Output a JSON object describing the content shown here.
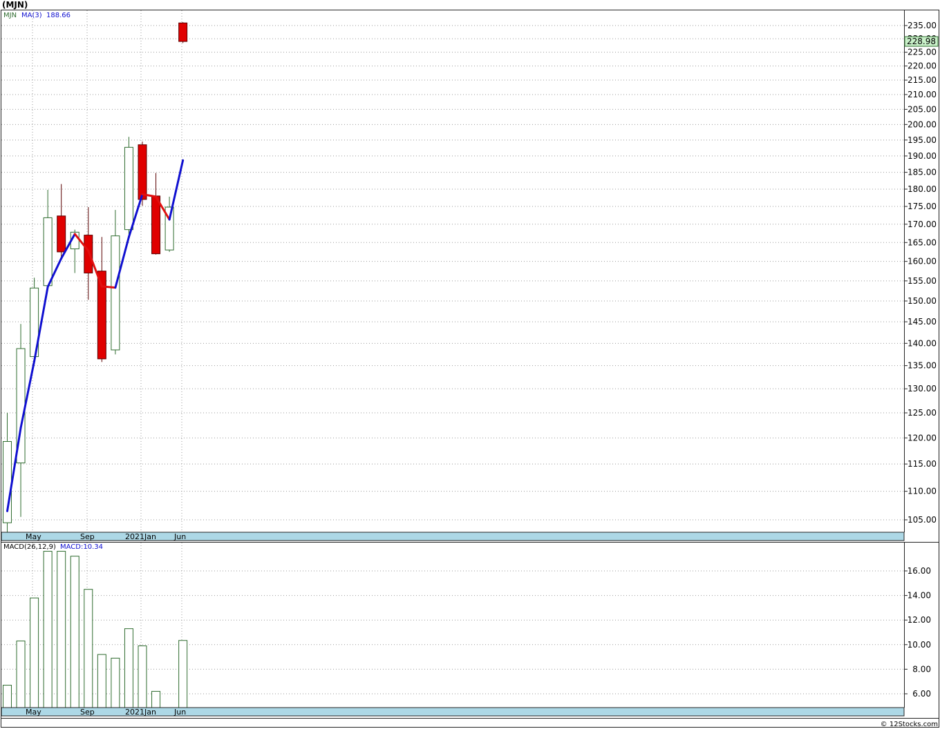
{
  "header": {
    "ticker_title": "(MJN)"
  },
  "price_panel": {
    "legend_symbol": "MJN",
    "legend_ma": "MA(3)",
    "legend_ma_value": "188.66",
    "current_price_label": "228.98"
  },
  "macd_panel": {
    "legend_params": "MACD(26,12,9)",
    "legend_value": "MACD:10.34"
  },
  "footer": {
    "watermark": "© 12Stocks.com"
  },
  "colors": {
    "up_candle_border": "#2e6b2e",
    "down_candle_fill": "#e00000",
    "ma_up": "#1010d0",
    "ma_down": "#e01010",
    "axis_band": "#add8e6",
    "price_label_bg": "#c8f0c8",
    "macd_bar": "#2e6b2e"
  },
  "chart_data": [
    {
      "type": "candlestick",
      "title": "(MJN)",
      "x_ticks": [
        "May",
        "Sep",
        "2021",
        "Jan",
        "Jun"
      ],
      "y_ticks": [
        "105.00",
        "110.00",
        "115.00",
        "120.00",
        "125.00",
        "130.00",
        "135.00",
        "140.00",
        "145.00",
        "150.00",
        "155.00",
        "160.00",
        "165.00",
        "170.00",
        "175.00",
        "180.00",
        "185.00",
        "190.00",
        "195.00",
        "200.00",
        "205.00",
        "210.00",
        "215.00",
        "220.00",
        "225.00",
        "230.00",
        "235.00"
      ],
      "ylim": [
        101.5,
        239
      ],
      "scale": "log",
      "grid": true,
      "candles": [
        {
          "open": 104.5,
          "high": 125.0,
          "low": 102.5,
          "close": 119.3
        },
        {
          "open": 115.2,
          "high": 144.5,
          "low": 105.5,
          "close": 138.8
        },
        {
          "open": 137.0,
          "high": 155.8,
          "low": 136.0,
          "close": 153.2
        },
        {
          "open": 153.8,
          "high": 179.8,
          "low": 153.0,
          "close": 171.8
        },
        {
          "open": 172.3,
          "high": 181.5,
          "low": 160.5,
          "close": 162.5
        },
        {
          "open": 163.3,
          "high": 168.5,
          "low": 157.0,
          "close": 167.8
        },
        {
          "open": 167.0,
          "high": 174.8,
          "low": 150.3,
          "close": 157.0
        },
        {
          "open": 157.5,
          "high": 166.5,
          "low": 135.8,
          "close": 136.5
        },
        {
          "open": 138.5,
          "high": 174.0,
          "low": 137.5,
          "close": 166.8
        },
        {
          "open": 168.5,
          "high": 196.0,
          "low": 167.0,
          "close": 192.7
        },
        {
          "open": 193.5,
          "high": 194.5,
          "low": 175.2,
          "close": 177.0
        },
        {
          "open": 178.0,
          "high": 184.8,
          "low": 161.8,
          "close": 162.0
        },
        {
          "open": 163.0,
          "high": 177.8,
          "low": 162.5,
          "close": 174.8
        },
        {
          "open": 236.0,
          "high": 236.3,
          "low": 228.4,
          "close": 228.98
        }
      ],
      "ma3": [
        106.5,
        122.0,
        136.0,
        153.5,
        160.8,
        167.3,
        162.8,
        153.6,
        153.3,
        166.5,
        178.5,
        177.8,
        171.3,
        188.66
      ]
    },
    {
      "type": "bar",
      "title": "MACD(26,12,9)",
      "x_ticks": [
        "May",
        "Sep",
        "2021",
        "Jan",
        "Jun"
      ],
      "y_ticks": [
        "6.00",
        "8.00",
        "10.00",
        "12.00",
        "14.00",
        "16.00"
      ],
      "ylim": [
        4.1,
        18.1
      ],
      "grid": true,
      "values": [
        6.7,
        10.3,
        13.8,
        17.6,
        17.6,
        17.2,
        14.5,
        9.2,
        8.9,
        11.3,
        9.9,
        6.2,
        null,
        10.34
      ]
    }
  ]
}
